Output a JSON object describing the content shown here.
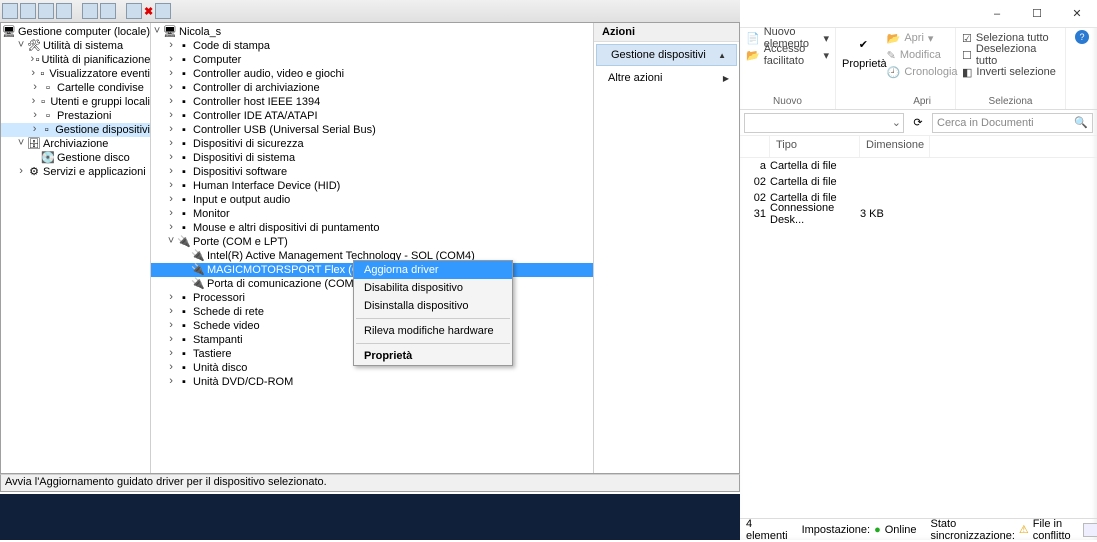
{
  "mmc": {
    "status": "Avvia l'Aggiornamento guidato driver per il dispositivo selezionato.",
    "left": {
      "root": "Gestione computer (locale)",
      "util": "Utilità di sistema",
      "util_items": [
        "Utilità di pianificazione",
        "Visualizzatore eventi",
        "Cartelle condivise",
        "Utenti e gruppi locali",
        "Prestazioni",
        "Gestione dispositivi"
      ],
      "arch": "Archiviazione",
      "arch_items": [
        "Gestione disco"
      ],
      "serv": "Servizi e applicazioni"
    },
    "tree": {
      "host": "Nicola_s",
      "items": [
        "Code di stampa",
        "Computer",
        "Controller audio, video e giochi",
        "Controller di archiviazione",
        "Controller host IEEE 1394",
        "Controller IDE ATA/ATAPI",
        "Controller USB (Universal Serial Bus)",
        "Dispositivi di sicurezza",
        "Dispositivi di sistema",
        "Dispositivi software",
        "Human Interface Device (HID)",
        "Input e output audio",
        "Monitor",
        "Mouse e altri dispositivi di puntamento"
      ],
      "ports": "Porte (COM e LPT)",
      "port_children": [
        "Intel(R) Active Management Technology - SOL (COM4)",
        "MAGICMOTORSPORT Flex (COM3)",
        "Porta di comunicazione (COM1)"
      ],
      "items2": [
        "Processori",
        "Schede di rete",
        "Schede video",
        "Stampanti",
        "Tastiere",
        "Unità disco",
        "Unità DVD/CD-ROM"
      ]
    },
    "ctx": {
      "update": "Aggiorna driver",
      "disable": "Disabilita dispositivo",
      "uninstall": "Disinstalla dispositivo",
      "scan": "Rileva modifiche hardware",
      "props": "Proprietà"
    },
    "actions": {
      "title": "Azioni",
      "main": "Gestione dispositivi",
      "other": "Altre azioni"
    }
  },
  "exp": {
    "ribbon": {
      "new": {
        "item": "Nuovo elemento",
        "easy": "Accesso facilitato",
        "label": "Nuovo"
      },
      "open": {
        "apri": "Apri",
        "edit": "Modifica",
        "hist": "Cronologia",
        "prop": "Proprietà",
        "label": "Apri"
      },
      "select": {
        "all": "Seleziona tutto",
        "none": "Deseleziona tutto",
        "inv": "Inverti selezione",
        "label": "Seleziona"
      }
    },
    "search_ph": "Cerca in Documenti",
    "cols": {
      "type": "Tipo",
      "size": "Dimensione"
    },
    "rows": [
      {
        "a": "a",
        "t": "Cartella di file",
        "s": ""
      },
      {
        "a": "02",
        "t": "Cartella di file",
        "s": ""
      },
      {
        "a": "02",
        "t": "Cartella di file",
        "s": ""
      },
      {
        "a": "31",
        "t": "Connessione Desk...",
        "s": "3 KB"
      }
    ],
    "status": {
      "count": "4 elementi",
      "imp": "Impostazione:",
      "online": "Online",
      "sync": "Stato sincronizzazione:",
      "conflict": "File in conflitto"
    }
  }
}
